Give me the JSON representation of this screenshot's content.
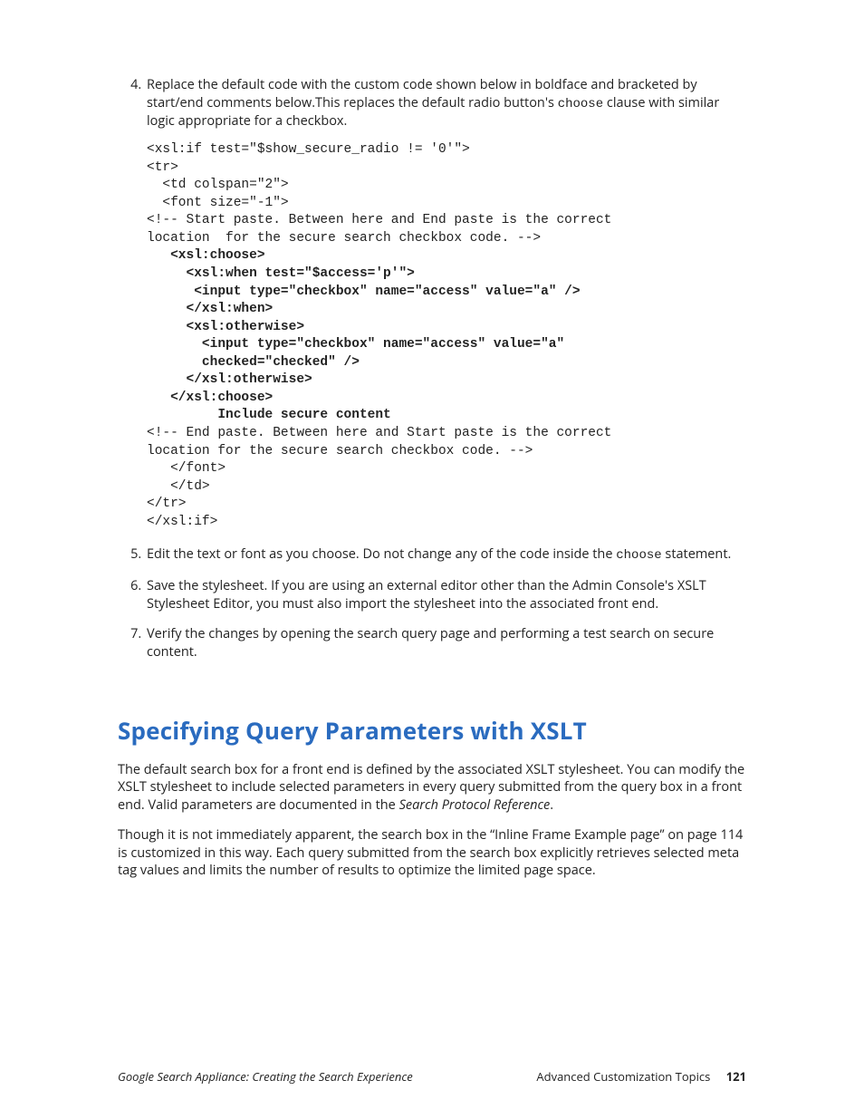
{
  "steps": {
    "s4": {
      "num": "4",
      "text_before": "Replace the default code with the custom code shown below in boldface and bracketed by start/end comments below.This replaces the default radio button's ",
      "code_inline": "choose",
      "text_after": " clause with similar logic appropriate for a checkbox.",
      "code": {
        "l01": "<xsl:if test=\"$show_secure_radio != '0'\">",
        "l02": "<tr>",
        "l03": "  <td colspan=\"2\">",
        "l04": "  <font size=\"-1\">",
        "l05": "<!-- Start paste. Between here and End paste is the correct",
        "l06": "location  for the secure search checkbox code. -->",
        "l07": "   <xsl:choose>",
        "l08": "     <xsl:when test=\"$access='p'\">",
        "l09": "      <input type=\"checkbox\" name=\"access\" value=\"a\" />",
        "l10": "     </xsl:when>",
        "l11": "     <xsl:otherwise>",
        "l12": "       <input type=\"checkbox\" name=\"access\" value=\"a\"",
        "l13": "       checked=\"checked\" />",
        "l14": "     </xsl:otherwise>",
        "l15": "   </xsl:choose>",
        "l16": "         Include secure content",
        "l17": "<!-- End paste. Between here and Start paste is the correct",
        "l18": "location for the secure search checkbox code. -->",
        "l19": "   </font>",
        "l20": "   </td>",
        "l21": "</tr>",
        "l22": "</xsl:if>"
      }
    },
    "s5": {
      "num": "5",
      "text_before": "Edit the text or font as you choose. Do not change any of the code inside the ",
      "code_inline": "choose",
      "text_after": " statement."
    },
    "s6": {
      "num": "6",
      "text": "Save the stylesheet. If you are using an external editor other than the Admin Console's XSLT Stylesheet Editor, you must also import the stylesheet into the associated front end."
    },
    "s7": {
      "num": "7",
      "text": "Verify the changes by opening the search query page and performing a test search on secure content."
    }
  },
  "section_heading": "Specifying Query Parameters with XSLT",
  "para1": {
    "before": "The default search box for a front end is defined by the associated XSLT stylesheet. You can modify the XSLT stylesheet to include selected parameters in every query submitted from the query box in a front end. Valid parameters are documented in the ",
    "ital": "Search Protocol Reference",
    "after": "."
  },
  "para2": "Though it is not immediately apparent, the search box in the “Inline Frame Example page” on page 114 is customized in this way. Each query submitted from the search box explicitly retrieves selected meta tag values and limits the number of results to optimize the limited page space.",
  "footer": {
    "left": "Google Search Appliance: Creating the Search Experience",
    "right_label": "Advanced Customization Topics",
    "page_number": "121"
  }
}
